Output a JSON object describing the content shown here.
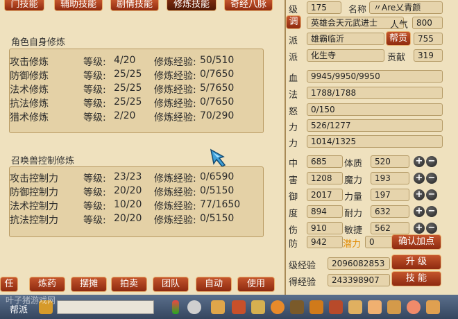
{
  "tabs": [
    {
      "label": "门技能",
      "active": false
    },
    {
      "label": "辅助技能",
      "active": false
    },
    {
      "label": "剧情技能",
      "active": false
    },
    {
      "label": "修炼技能",
      "active": true
    },
    {
      "label": "奇经八脉",
      "active": false
    }
  ],
  "self_section": {
    "title": "角色自身修炼",
    "rows": [
      {
        "name": "攻击修炼",
        "level_label": "等级:",
        "level": "4/20",
        "exp_label": "修炼经验:",
        "exp": "50/510"
      },
      {
        "name": "防御修炼",
        "level_label": "等级:",
        "level": "25/25",
        "exp_label": "修炼经验:",
        "exp": "0/7650"
      },
      {
        "name": "法术修炼",
        "level_label": "等级:",
        "level": "25/25",
        "exp_label": "修炼经验:",
        "exp": "5/7650"
      },
      {
        "name": "抗法修炼",
        "level_label": "等级:",
        "level": "25/25",
        "exp_label": "修炼经验:",
        "exp": "0/7650"
      },
      {
        "name": "猎术修炼",
        "level_label": "等级:",
        "level": "2/20",
        "exp_label": "修炼经验:",
        "exp": "70/290"
      }
    ]
  },
  "pet_section": {
    "title": "召唤兽控制修炼",
    "rows": [
      {
        "name": "攻击控制力",
        "level_label": "等级:",
        "level": "23/23",
        "exp_label": "修炼经验:",
        "exp": "0/6590"
      },
      {
        "name": "防御控制力",
        "level_label": "等级:",
        "level": "20/20",
        "exp_label": "修炼经验:",
        "exp": "0/5150"
      },
      {
        "name": "法术控制力",
        "level_label": "等级:",
        "level": "10/20",
        "exp_label": "修炼经验:",
        "exp": "77/1650"
      },
      {
        "name": "抗法控制力",
        "level_label": "等级:",
        "level": "20/20",
        "exp_label": "修炼经验:",
        "exp": "0/5150"
      }
    ]
  },
  "bottom_buttons": [
    "任",
    "炼药",
    "摆摊",
    "拍卖",
    "团队",
    "自动",
    "使用"
  ],
  "attributes": {
    "level_label": "级",
    "level": "175",
    "name_label": "名称",
    "name": "〃Are乂青颜",
    "title_btn": "调",
    "title": "英雄会天元武进士",
    "popularity_label": "人气",
    "popularity": "800",
    "faction_label": "派",
    "faction": "雄霸临沂",
    "faction_btn": "帮贡",
    "contribution": "755",
    "school_label": "派",
    "school": "化生寺",
    "merit_label": "贡献",
    "merit": "319",
    "hp_label": "血",
    "hp": "9945/9950/9950",
    "mp_label": "法",
    "mp": "1788/1788",
    "anger_label": "怒",
    "anger": "0/150",
    "vitality_label": "力",
    "vitality": "526/1277",
    "energy_label": "力",
    "energy": "1014/1325"
  },
  "stats": [
    {
      "left_label": "中",
      "left_value": "685",
      "right_label": "体质",
      "right_value": "520"
    },
    {
      "left_label": "害",
      "left_value": "1208",
      "right_label": "魔力",
      "right_value": "193"
    },
    {
      "left_label": "御",
      "left_value": "2017",
      "right_label": "力量",
      "right_value": "197"
    },
    {
      "left_label": "度",
      "left_value": "894",
      "right_label": "耐力",
      "right_value": "632"
    },
    {
      "left_label": "伤",
      "left_value": "910",
      "right_label": "敏捷",
      "right_value": "562"
    }
  ],
  "potential": {
    "left_label": "防",
    "left_value": "942",
    "label": "潜力",
    "value": "0",
    "confirm_btn": "确认加点"
  },
  "experience": {
    "upgrade_label": "级经验",
    "upgrade_value": "2096082853",
    "upgrade_btn": "升 级",
    "gained_label": "得经验",
    "gained_value": "243398907",
    "skill_btn": "技 能"
  },
  "taskbar": {
    "channel_label": "帮派",
    "watermark": "叶子猪游戏网"
  },
  "colors": {
    "panel_bg": "#efe1be",
    "button_red": "#b0401c",
    "potential_label": "#e08a00"
  }
}
